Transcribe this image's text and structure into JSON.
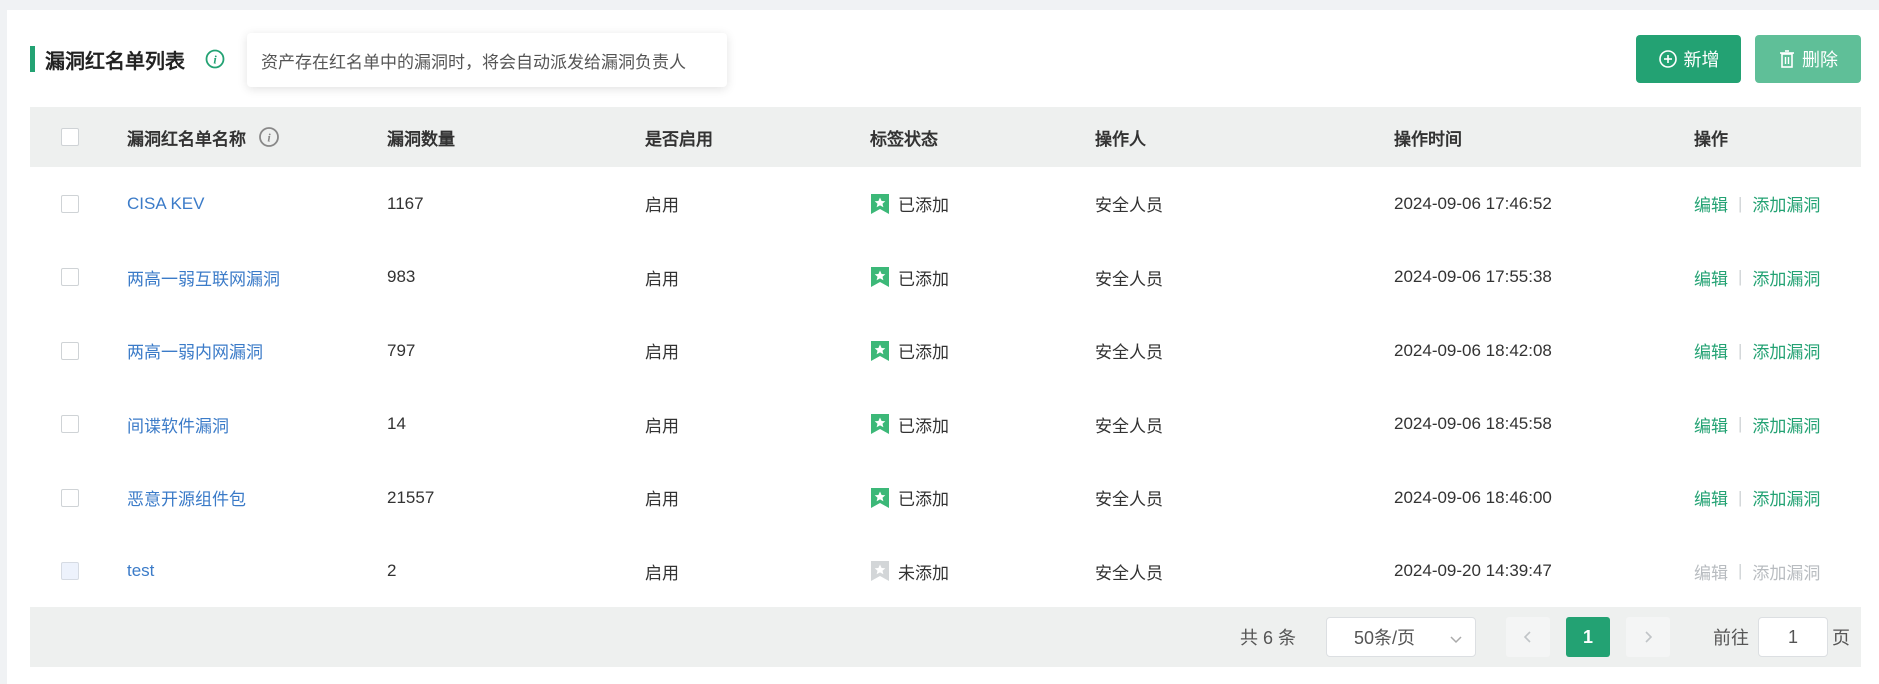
{
  "header": {
    "title": "漏洞红名单列表",
    "tooltip": "资产存在红名单中的漏洞时，将会自动派发给漏洞负责人",
    "add_label": "新增",
    "delete_label": "删除"
  },
  "table": {
    "columns": [
      "漏洞红名单名称",
      "漏洞数量",
      "是否启用",
      "标签状态",
      "操作人",
      "操作时间",
      "操作"
    ],
    "rows": [
      {
        "name": "CISA KEV",
        "count": "1167",
        "enabled": "启用",
        "tag": "已添加",
        "tag_added": true,
        "operator": "安全人员",
        "time": "2024-09-06 17:46:52"
      },
      {
        "name": "两高一弱互联网漏洞",
        "count": "983",
        "enabled": "启用",
        "tag": "已添加",
        "tag_added": true,
        "operator": "安全人员",
        "time": "2024-09-06 17:55:38"
      },
      {
        "name": "两高一弱内网漏洞",
        "count": "797",
        "enabled": "启用",
        "tag": "已添加",
        "tag_added": true,
        "operator": "安全人员",
        "time": "2024-09-06 18:42:08"
      },
      {
        "name": "间谍软件漏洞",
        "count": "14",
        "enabled": "启用",
        "tag": "已添加",
        "tag_added": true,
        "operator": "安全人员",
        "time": "2024-09-06 18:45:58"
      },
      {
        "name": "恶意开源组件包",
        "count": "21557",
        "enabled": "启用",
        "tag": "已添加",
        "tag_added": true,
        "operator": "安全人员",
        "time": "2024-09-06 18:46:00"
      },
      {
        "name": "test",
        "count": "2",
        "enabled": "启用",
        "tag": "未添加",
        "tag_added": false,
        "operator": "安全人员",
        "time": "2024-09-20 14:39:47"
      }
    ],
    "action_edit": "编辑",
    "action_add_vuln": "添加漏洞"
  },
  "pagination": {
    "total_text": "共 6 条",
    "page_size": "50条/页",
    "current_page": "1",
    "goto_label": "前往",
    "goto_value": "1",
    "page_label": "页"
  },
  "colors": {
    "primary": "#23a273",
    "link": "#3b7bc8",
    "disabled": "#b8bcc0"
  }
}
